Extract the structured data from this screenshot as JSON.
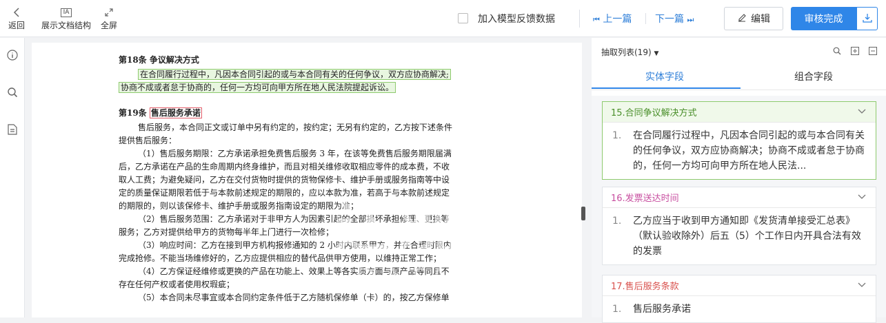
{
  "toolbar": {
    "back_label": "返回",
    "structure_label": "展示文档结构",
    "structure_icon_text": "IA",
    "fullscreen_label": "全屏",
    "feedback_label": "加入模型反馈数据",
    "prev_label": "上一篇",
    "next_label": "下一篇",
    "edit_label": "编辑",
    "done_label": "审核完成"
  },
  "doc": {
    "art18_title": "第18条 争议解决方式",
    "art18_p1": "在合同履行过程中，凡因本合同引起的或与本合同有关的任何争议，双方应协商解决;",
    "art18_p2": "协商不成或者怠于协商的，任何一方均可向甲方所在地人民法院提起诉讼。",
    "art19_prefix": "第19条 ",
    "art19_title": "售后服务承诺",
    "lines": [
      {
        "text": "售后服务，本合同正文或订单中另有约定的，按约定；无另有约定的，乙方按下述条件",
        "indent": true
      },
      {
        "text": "提供售后服务：",
        "indent": false
      },
      {
        "text": "（1）售后服务期限：乙方承诺承担免费售后服务 3 年，在该等免费售后服务期限届满",
        "indent": true
      },
      {
        "text": "后，乙方承诺在产品的生命周期内终身维护，而且对相关维修收取相应零件的成本费，不收",
        "indent": false
      },
      {
        "text": "取人工费；为避免疑问，乙方在交付货物时提供的货物保修卡、维护手册或服务指南等中设",
        "indent": false
      },
      {
        "text": "定的质量保证期限若低于与本款前述规定的期限的，应以本款为准，若高于与本款前述规定",
        "indent": false
      },
      {
        "text": "的期限的，则以该保修卡、维护手册或服务指南设定的期限为准；",
        "indent": false
      },
      {
        "text": "（2）售后服务范围：乙方承诺对于非甲方人为因素引起的全部损坏承担修理、更换等",
        "indent": true
      },
      {
        "text": "服务；乙方对提供给甲方的货物每半年上门进行一次检修；",
        "indent": false
      },
      {
        "text": "（3）响应时间：乙方在接到甲方机构报修通知的 2 小时内联系甲方，并在合理时限内",
        "indent": true
      },
      {
        "text": "完成抢修。不能当场维修好的，乙方应提供相应的替代品供甲方使用，以维持正常工作；",
        "indent": false
      },
      {
        "text": "（4）乙方保证经维修或更换的产品在功能上、效果上等各实质方面与原产品等同且不",
        "indent": true
      },
      {
        "text": "存在任何产权或者使用权瑕疵；",
        "indent": false
      },
      {
        "text": "（5）本合同未尽事宜或本合同约定条件低于乙方随机保修单（卡）的，按乙方保修单",
        "indent": true
      }
    ]
  },
  "panel": {
    "list_title": "抽取列表(19)",
    "tab_entity": "实体字段",
    "tab_combo": "组合字段",
    "cards": [
      {
        "title": "15.合同争议解决方式",
        "num": "1.",
        "text": "在合同履行过程中，凡因本合同引起的或与本合同有关的任何争议，双方应协商解决；协商不成或者怠于协商的，任何一方均可向甲方所在地人民法..."
      },
      {
        "title": "16.发票送达时间",
        "num": "1.",
        "text": "乙方应当于收到甲方通知即《发货清单接受汇总表》（默认验收除外）后五（5）个工作日内开具合法有效的发票"
      },
      {
        "title": "17.售后服务条款",
        "num": "1.",
        "text": "售后服务承诺"
      }
    ]
  },
  "watermark": {
    "main": "达观数据",
    "sub": "DATA GRAND"
  },
  "colors": {
    "accent": "#2f86e8",
    "green_highlight": "#8dca6d",
    "red_highlight": "#e35d6a"
  }
}
